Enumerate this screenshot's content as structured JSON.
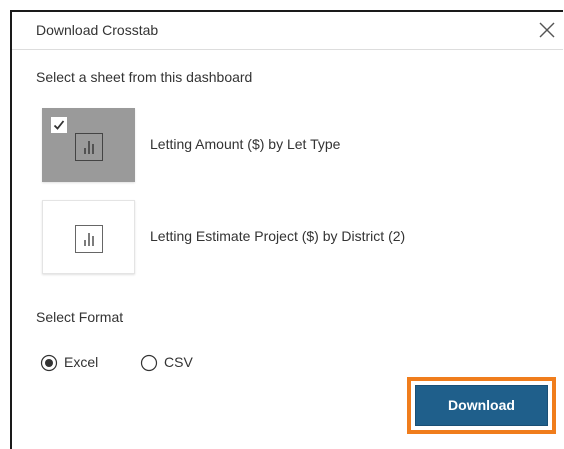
{
  "dialog": {
    "title": "Download Crosstab"
  },
  "sheets_section": {
    "label": "Select a sheet from this dashboard",
    "sheets": [
      {
        "label": "Letting Amount ($) by Let Type",
        "selected": true
      },
      {
        "label": "Letting Estimate Project ($) by District (2)",
        "selected": false
      }
    ]
  },
  "format_section": {
    "label": "Select Format",
    "options": [
      {
        "label": "Excel",
        "selected": true
      },
      {
        "label": "CSV",
        "selected": false
      }
    ]
  },
  "actions": {
    "download_label": "Download"
  },
  "colors": {
    "primary_button": "#1f5f8b",
    "highlight": "#f07d1c",
    "selected_thumb": "#9a9a9a"
  },
  "icons": {
    "close": "close-icon",
    "chart": "bar-chart-icon",
    "check": "checkmark-icon"
  }
}
